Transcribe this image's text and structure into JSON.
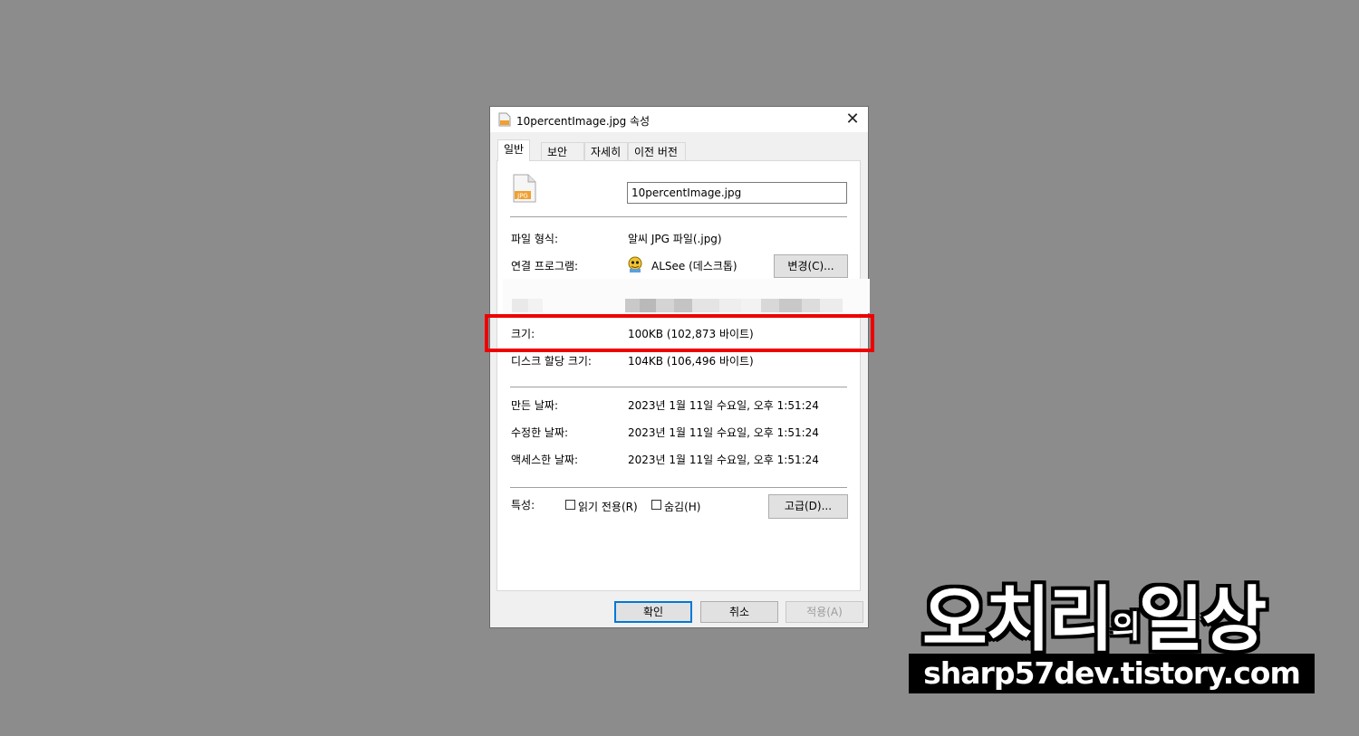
{
  "window": {
    "title": "10percentImage.jpg 속성",
    "close_symbol": "✕"
  },
  "tabs": [
    {
      "label": "일반",
      "active": true
    },
    {
      "label": "보안",
      "active": false
    },
    {
      "label": "자세히",
      "active": false
    },
    {
      "label": "이전 버전",
      "active": false
    }
  ],
  "general": {
    "file_icon_text": "JPG",
    "filename_value": "10percentImage.jpg",
    "file_type_label": "파일 형식:",
    "file_type_value": "알씨 JPG 파일(.jpg)",
    "opens_with_label": "연결 프로그램:",
    "opens_with_value": "ALSee (데스크톱)",
    "change_button": "변경(C)...",
    "size_label": "크기:",
    "size_value": "100KB (102,873 바이트)",
    "size_on_disk_label": "디스크 할당 크기:",
    "size_on_disk_value": "104KB (106,496 바이트)",
    "created_label": "만든 날짜:",
    "created_value": "2023년 1월 11일 수요일, 오후 1:51:24",
    "modified_label": "수정한 날짜:",
    "modified_value": "2023년 1월 11일 수요일, 오후 1:51:24",
    "accessed_label": "액세스한 날짜:",
    "accessed_value": "2023년 1월 11일 수요일, 오후 1:51:24",
    "attributes_label": "특성:",
    "readonly_label": "읽기 전용(R)",
    "hidden_label": "숨김(H)",
    "advanced_button": "고급(D)..."
  },
  "footer": {
    "ok_button": "확인",
    "cancel_button": "취소",
    "apply_button": "적용(A)"
  },
  "watermark": {
    "name_main": "오치리",
    "name_particle": "의",
    "name_tail": "일상",
    "url": "sharp57dev.tistory.com"
  },
  "colors": {
    "highlight": "#ee0000",
    "background": "#8c8c8c",
    "accent": "#0078d7"
  }
}
